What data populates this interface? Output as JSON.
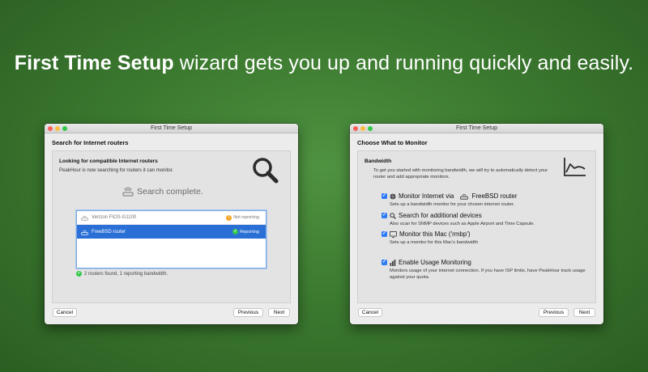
{
  "headline": {
    "bold": "First Time Setup",
    "rest": " wizard gets you up and running quickly and easily."
  },
  "window1": {
    "title": "First Time Setup",
    "section_title": "Search for Internet routers",
    "heading": "Looking for compatible Internet routers",
    "subtext": "PeakHour is now searching for routers it can monitor.",
    "search_status": "Search complete.",
    "routers": [
      {
        "name": "Verizon FIOS-G1100",
        "status": "Not reporting",
        "selected": false
      },
      {
        "name": "FreeBSD router",
        "status": "Reporting",
        "selected": true
      }
    ],
    "result_text": "2 routers found, 1 reporting bandwidth.",
    "buttons": {
      "cancel": "Cancel",
      "previous": "Previous",
      "next": "Next"
    }
  },
  "window2": {
    "title": "First Time Setup",
    "section_title": "Choose What to Monitor",
    "heading": "Bandwidth",
    "subtext": "To get you started with monitoring bandwidth, we will try to automatically detect your router and add appropriate monitors.",
    "options": [
      {
        "label_prefix": "Monitor Internet via",
        "label_suffix": "FreeBSD router",
        "description": "Sets up a bandwidth monitor for your chosen internet router.",
        "checked": true
      },
      {
        "label": "Search for additional devices",
        "description": "Also scan for SNMP devices such as Apple Airport and Time Capsule.",
        "checked": true
      },
      {
        "label": "Monitor this Mac ('rmbp')",
        "description": "Sets up a monitor for this Mac's bandwidth",
        "checked": true
      },
      {
        "label": "Enable Usage Monitoring",
        "description": "Monitors usage of your internet connection. If you have ISP limits, have PeakHour track usage against your quota.",
        "checked": true
      }
    ],
    "buttons": {
      "cancel": "Cancel",
      "previous": "Previous",
      "next": "Next"
    }
  },
  "colors": {
    "accent": "#2a6fd6",
    "checkbox": "#2f7cf6",
    "reporting": "#34c84a",
    "not_reporting": "#f5a623"
  },
  "icons": [
    "magnifier-icon",
    "router-icon",
    "bandwidth-graph-icon",
    "globe-icon",
    "search-icon",
    "monitor-icon",
    "usage-bars-icon",
    "check-icon"
  ]
}
